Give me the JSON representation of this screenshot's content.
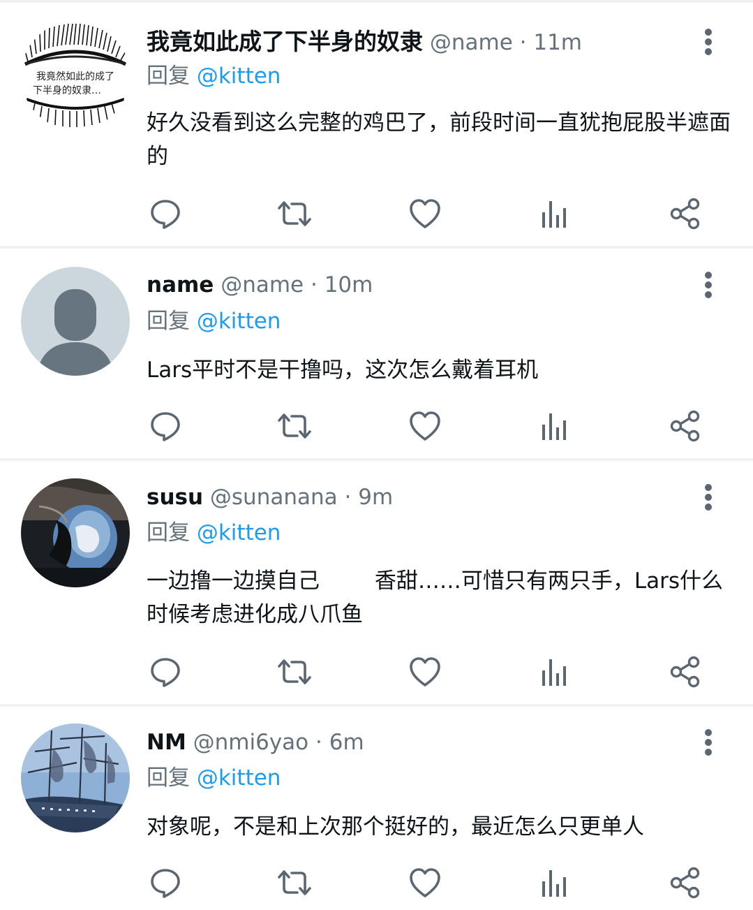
{
  "colors": {
    "text_primary": "#0f1419",
    "text_secondary": "#65717b",
    "link": "#1d9bf0",
    "divider": "#eff1f3",
    "icon": "#5b6670"
  },
  "icons": {
    "reply": "comment-icon",
    "retweet": "retweet-icon",
    "like": "heart-icon",
    "views": "views-bar-chart-icon",
    "share": "share-icon",
    "more": "vertical-ellipsis-icon"
  },
  "tweets": [
    {
      "display_name": "我竟如此成了下半身的奴隶",
      "handle": "@name",
      "separator": "·",
      "time": "11m",
      "reply_prefix": "回复",
      "reply_to": "@kitten",
      "body": "好久没看到这么完整的鸡巴了，前段时间一直犹抱屁股半遮面的",
      "avatar_text_line1": "我竟然如此的成了",
      "avatar_text_line2": "下半身的奴隶…"
    },
    {
      "display_name": "name",
      "handle": "@name",
      "separator": "·",
      "time": "10m",
      "reply_prefix": "回复",
      "reply_to": "@kitten",
      "body": "Lars平时不是干撸吗，这次怎么戴着耳机"
    },
    {
      "display_name": "susu",
      "handle": "@sunanana",
      "separator": "·",
      "time": "9m",
      "reply_prefix": "回复",
      "reply_to": "@kitten",
      "body": "一边撸一边摸自己        香甜……可惜只有两只手，Lars什么时候考虑进化成八爪鱼"
    },
    {
      "display_name": "NM",
      "handle": "@nmi6yao",
      "separator": "·",
      "time": "6m",
      "reply_prefix": "回复",
      "reply_to": "@kitten",
      "body": "对象呢，不是和上次那个挺好的，最近怎么只更单人"
    }
  ]
}
